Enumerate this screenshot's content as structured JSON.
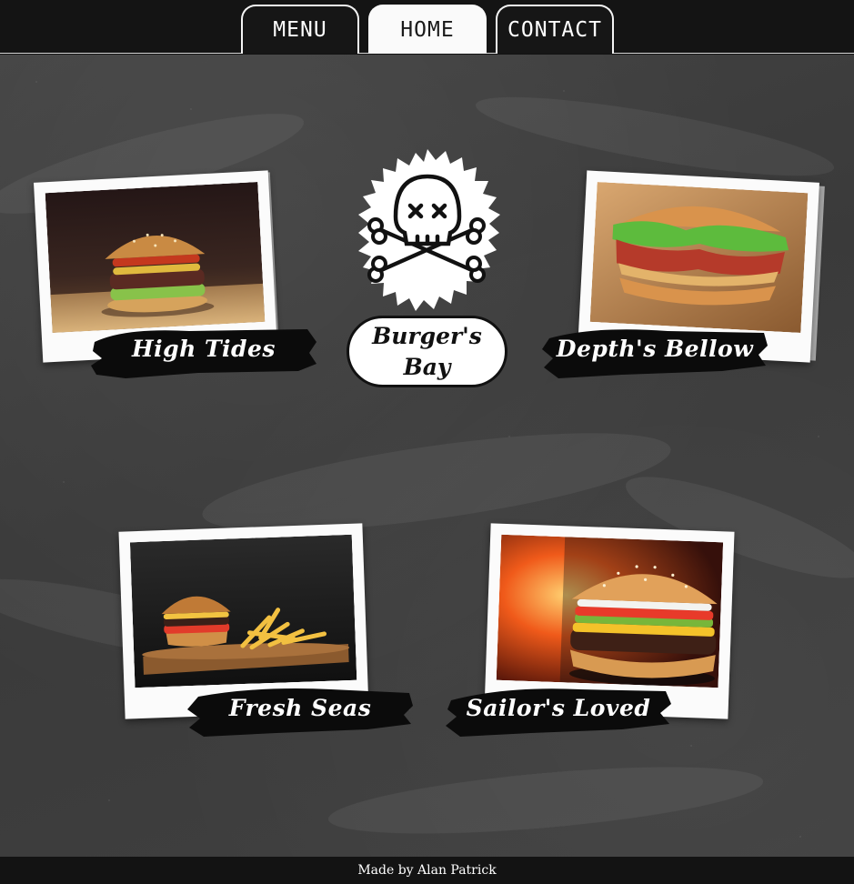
{
  "nav": {
    "tabs": [
      {
        "label": "MENU",
        "active": false
      },
      {
        "label": "HOME",
        "active": true
      },
      {
        "label": "CONTACT",
        "active": false
      }
    ]
  },
  "logo": {
    "icon": "skull-crossbones-icon",
    "name_line1": "Burger's",
    "name_line2": "Bay"
  },
  "burgers": [
    {
      "name": "High Tides",
      "image": "burger-wood-table-photo"
    },
    {
      "name": "Depth's Bellow",
      "image": "bacon-lettuce-burger-photo"
    },
    {
      "name": "Fresh Seas",
      "image": "burger-and-fries-photo"
    },
    {
      "name": "Sailor's Loved",
      "image": "burger-fire-background-photo"
    }
  ],
  "footer": {
    "credit": "Made by Alan Patrick"
  },
  "colors": {
    "bar_bg": "#141414",
    "board": "#3e3e3e",
    "active_tab": "#fafafa",
    "polaroid": "#fbfbfb",
    "brush": "#0b0b0b"
  }
}
